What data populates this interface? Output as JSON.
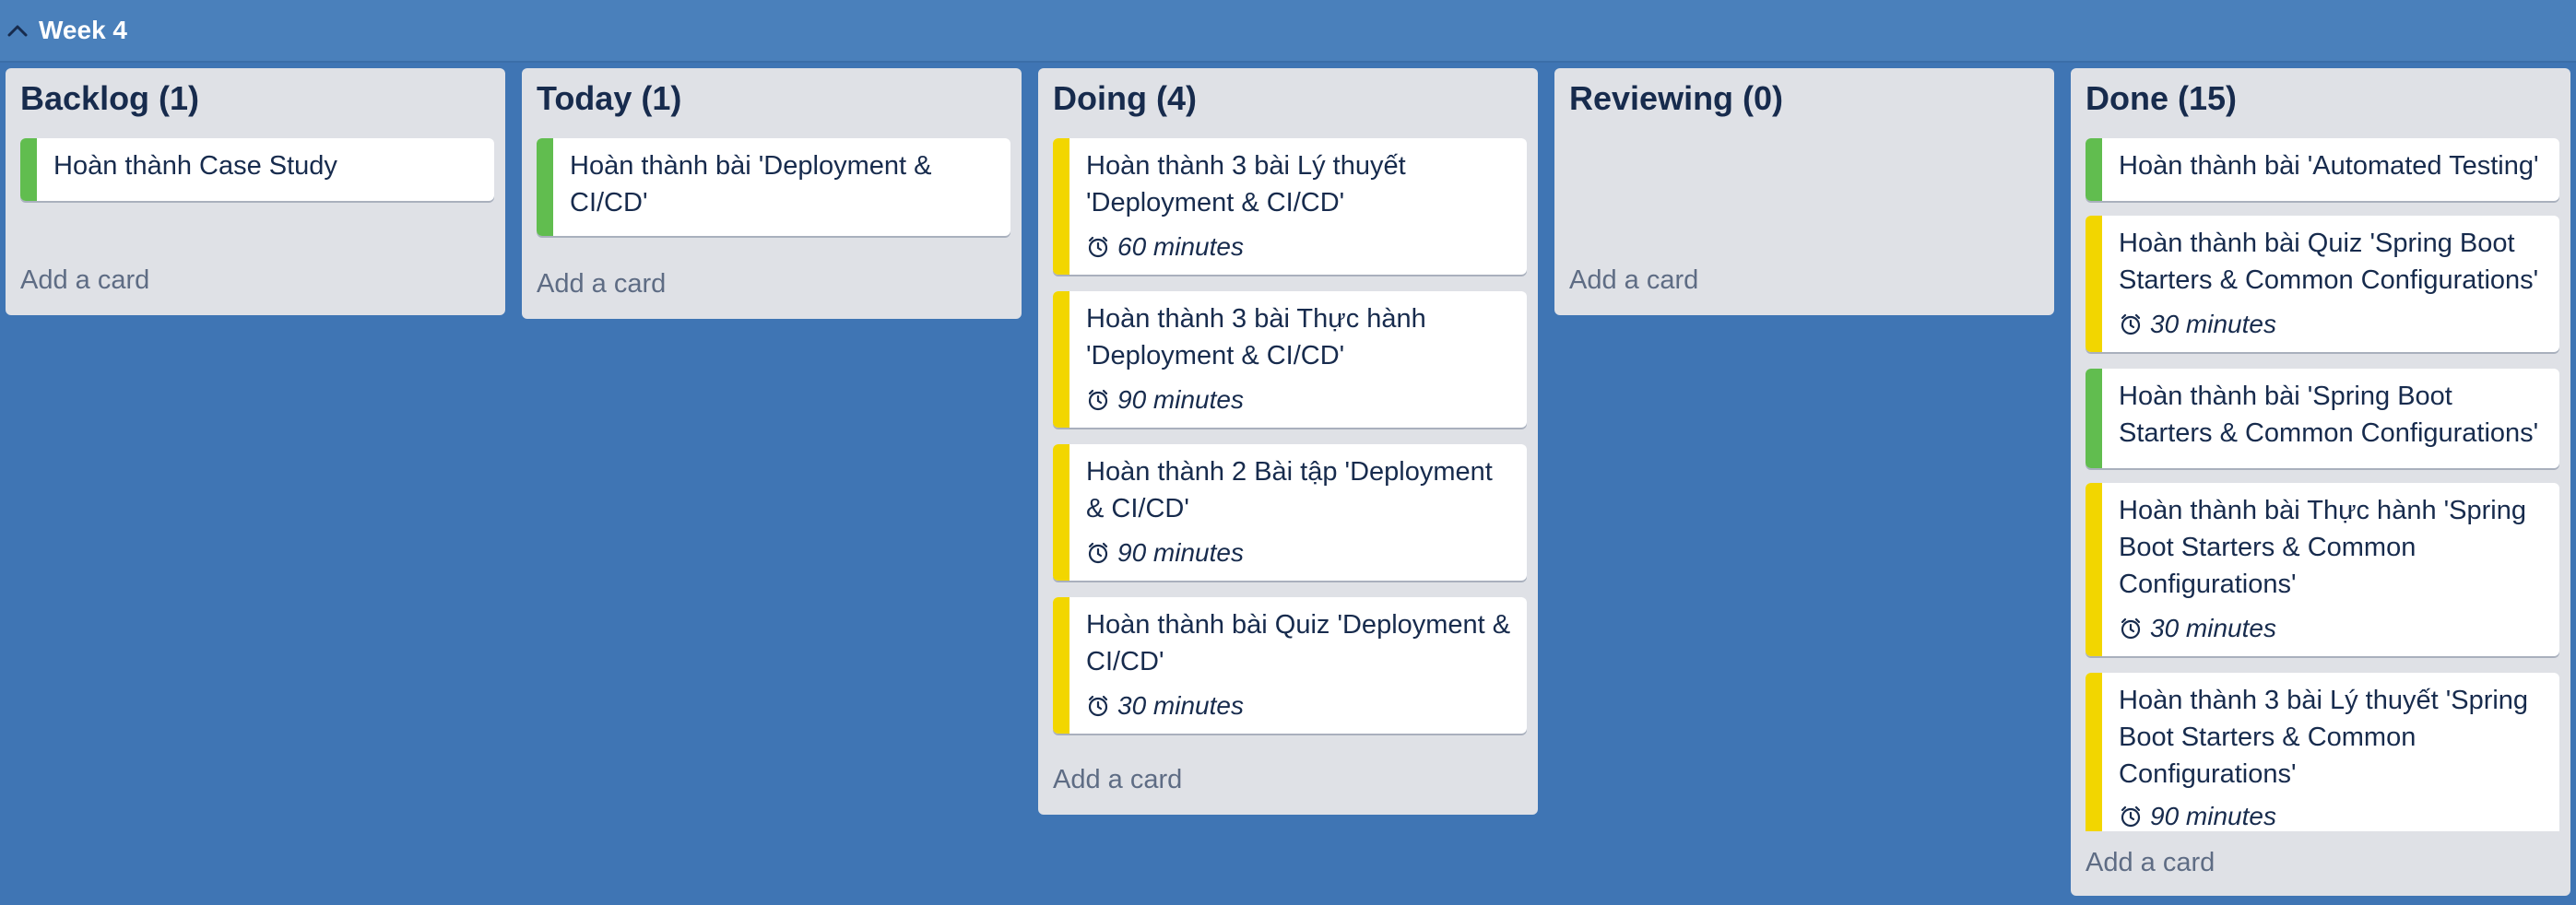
{
  "board": {
    "week_title": "Week 4",
    "add_card_label": "Add a card"
  },
  "colors": {
    "background": "#3f75b4",
    "list": "#dfe1e6",
    "label_green": "#61bd4f",
    "label_yellow": "#f2d600"
  },
  "icons": {
    "collapse": "chevron-up-icon",
    "timer": "clock-icon"
  },
  "lists": [
    {
      "title": "Backlog (1)",
      "cards": [
        {
          "title": "Hoàn thành Case Study",
          "label": "green",
          "duration": null
        }
      ]
    },
    {
      "title": "Today (1)",
      "cards": [
        {
          "title": "Hoàn thành bài 'Deployment & CI/CD'",
          "label": "green",
          "duration": null
        }
      ]
    },
    {
      "title": "Doing (4)",
      "cards": [
        {
          "title": "Hoàn thành 3 bài Lý thuyết 'Deployment & CI/CD'",
          "label": "yellow",
          "duration": "60 minutes"
        },
        {
          "title": "Hoàn thành 3 bài Thực hành 'Deployment & CI/CD'",
          "label": "yellow",
          "duration": "90 minutes"
        },
        {
          "title": "Hoàn thành 2 Bài tập 'Deployment & CI/CD'",
          "label": "yellow",
          "duration": "90 minutes"
        },
        {
          "title": "Hoàn thành bài Quiz 'Deployment & CI/CD'",
          "label": "yellow",
          "duration": "30 minutes"
        }
      ]
    },
    {
      "title": "Reviewing (0)",
      "cards": []
    },
    {
      "title": "Done (15)",
      "cards": [
        {
          "title": "Hoàn thành bài 'Automated Testing'",
          "label": "green",
          "duration": null
        },
        {
          "title": "Hoàn thành bài Quiz 'Spring Boot Starters & Common Configurations'",
          "label": "yellow",
          "duration": "30 minutes"
        },
        {
          "title": "Hoàn thành bài 'Spring Boot Starters & Common Configurations'",
          "label": "green",
          "duration": null
        },
        {
          "title": "Hoàn thành bài Thực hành 'Spring Boot Starters & Common Configurations'",
          "label": "yellow",
          "duration": "30 minutes"
        },
        {
          "title": "Hoàn thành 3 bài Lý thuyết 'Spring Boot Starters & Common Configurations'",
          "label": "yellow",
          "duration": "90 minutes"
        }
      ]
    }
  ]
}
